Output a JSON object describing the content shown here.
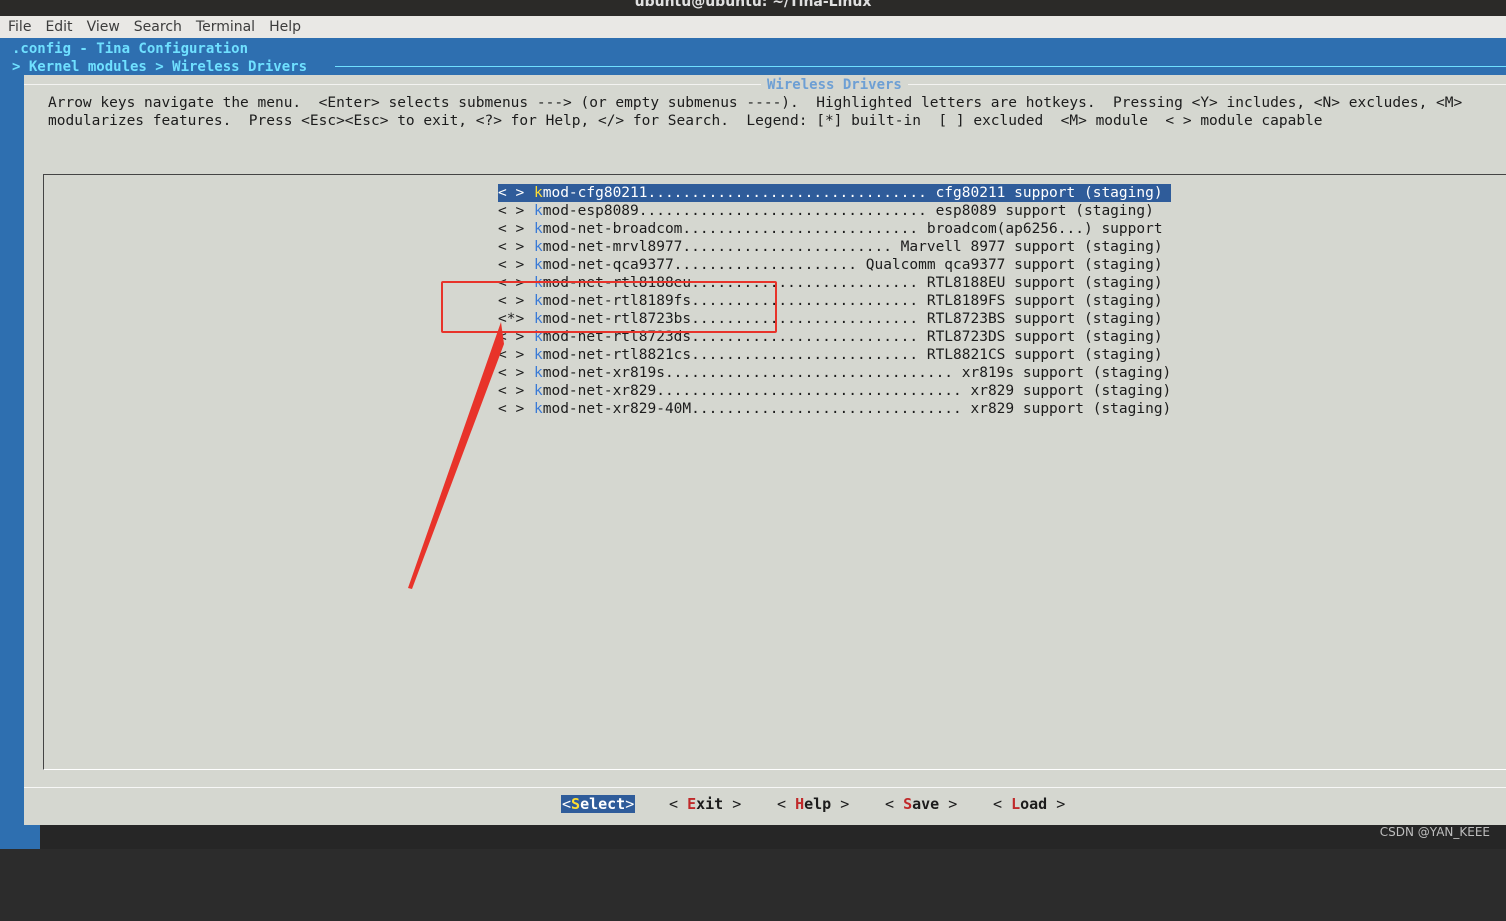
{
  "window": {
    "title": "ubuntu@ubuntu: ~/Tina-Linux"
  },
  "menubar": {
    "items": [
      "File",
      "Edit",
      "View",
      "Search",
      "Terminal",
      "Help"
    ]
  },
  "header": {
    "config_title": ".config - Tina Configuration",
    "breadcrumb": "> Kernel modules > Wireless Drivers"
  },
  "dialog": {
    "title": "Wireless Drivers",
    "help_line1": "Arrow keys navigate the menu.  <Enter> selects submenus ---> (or empty submenus ----).  Highlighted letters are hotkeys.  Pressing <Y> includes, <N> excludes, <M>",
    "help_line2": "modularizes features.  Press <Esc><Esc> to exit, <?> for Help, </> for Search.  Legend: [*] built-in  [ ] excluded  <M> module  < > module capable"
  },
  "items": [
    {
      "mark": "< >",
      "hotkey": "k",
      "rest": "mod-cfg80211................................ cfg80211 support (staging)",
      "selected": true
    },
    {
      "mark": "< >",
      "hotkey": "k",
      "rest": "mod-esp8089................................. esp8089 support (staging)",
      "selected": false
    },
    {
      "mark": "< >",
      "hotkey": "k",
      "rest": "mod-net-broadcom........................... broadcom(ap6256...) support",
      "selected": false
    },
    {
      "mark": "< >",
      "hotkey": "k",
      "rest": "mod-net-mrvl8977........................ Marvell 8977 support (staging)",
      "selected": false
    },
    {
      "mark": "< >",
      "hotkey": "k",
      "rest": "mod-net-qca9377..................... Qualcomm qca9377 support (staging)",
      "selected": false
    },
    {
      "mark": "< >",
      "hotkey": "k",
      "rest": "mod-net-rtl8188eu.......................... RTL8188EU support (staging)",
      "selected": false
    },
    {
      "mark": "< >",
      "hotkey": "k",
      "rest": "mod-net-rtl8189fs.......................... RTL8189FS support (staging)",
      "selected": false
    },
    {
      "mark": "<*>",
      "hotkey": "k",
      "rest": "mod-net-rtl8723bs.......................... RTL8723BS support (staging)",
      "selected": false
    },
    {
      "mark": "< >",
      "hotkey": "k",
      "rest": "mod-net-rtl8723ds.......................... RTL8723DS support (staging)",
      "selected": false
    },
    {
      "mark": "< >",
      "hotkey": "k",
      "rest": "mod-net-rtl8821cs.......................... RTL8821CS support (staging)",
      "selected": false
    },
    {
      "mark": "< >",
      "hotkey": "k",
      "rest": "mod-net-xr819s................................. xr819s support (staging)",
      "selected": false
    },
    {
      "mark": "< >",
      "hotkey": "k",
      "rest": "mod-net-xr829................................... xr829 support (staging)",
      "selected": false
    },
    {
      "mark": "< >",
      "hotkey": "k",
      "rest": "mod-net-xr829-40M............................... xr829 support (staging)",
      "selected": false
    }
  ],
  "buttons": {
    "select": {
      "open": "<",
      "hotkey": "S",
      "rest": "elect",
      "close": ">"
    },
    "exit": {
      "open": "< ",
      "hotkey": "E",
      "rest": "xit",
      "close": " >"
    },
    "help": {
      "open": "< ",
      "hotkey": "H",
      "rest": "elp",
      "close": " >"
    },
    "save": {
      "open": "< ",
      "hotkey": "S",
      "rest": "ave",
      "close": " >"
    },
    "load": {
      "open": "< ",
      "hotkey": "L",
      "rest": "oad",
      "close": " >"
    }
  },
  "annotation": {
    "color": "#e8332a"
  },
  "watermark": "CSDN @YAN_KEEE"
}
